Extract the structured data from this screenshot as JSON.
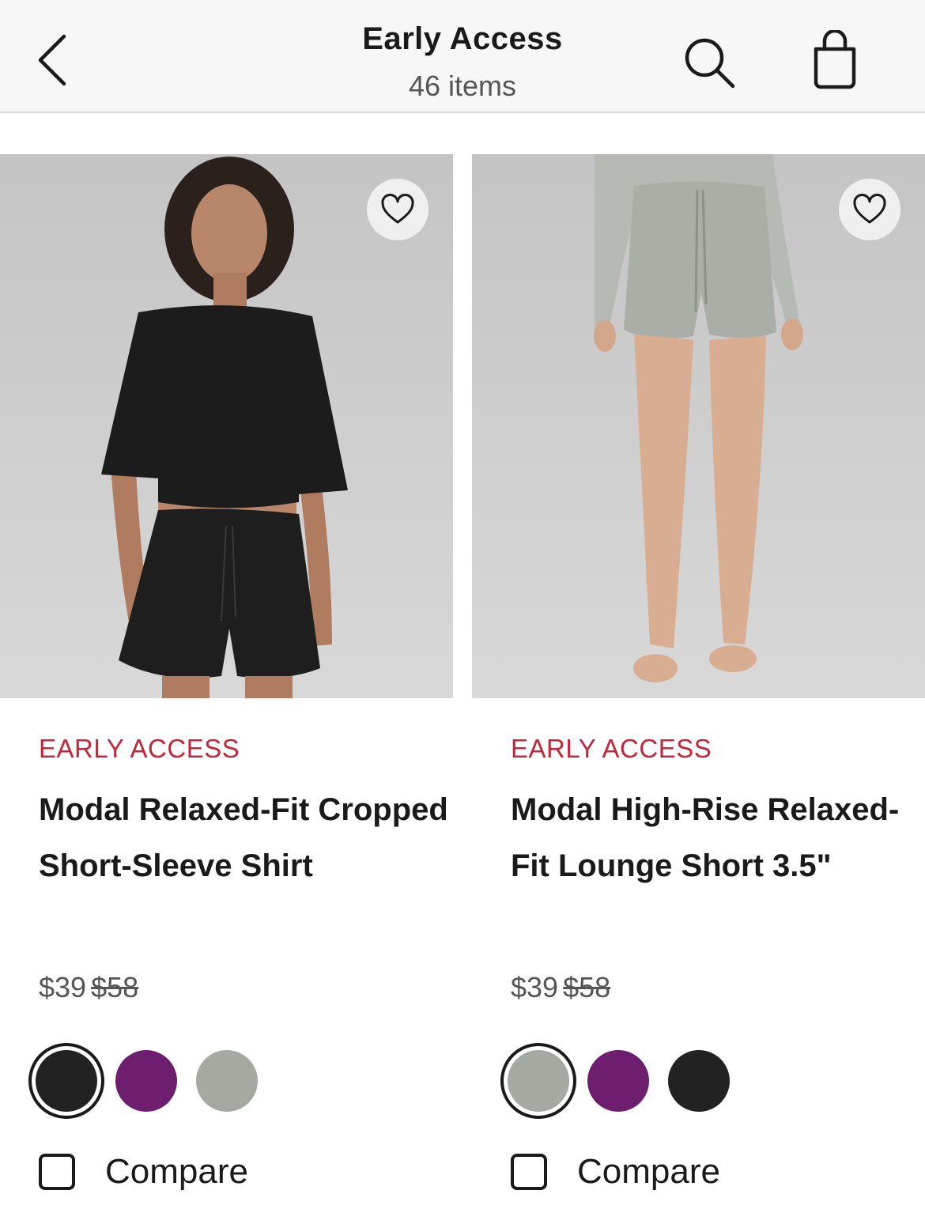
{
  "header": {
    "title": "Early Access",
    "item_count": "46 items"
  },
  "colors": {
    "accent_red": "#c0283a",
    "swatch_black": "#222222",
    "swatch_purple": "#6e1e6e",
    "swatch_sage": "#a4aaa2"
  },
  "products": [
    {
      "badge": "EARLY ACCESS",
      "name": "Modal Relaxed-Fit Cropped Short-Sleeve Shirt",
      "price_sale": "$39",
      "price_original": "$58",
      "compare_label": "Compare",
      "swatches": [
        "black",
        "purple",
        "sage"
      ],
      "selected_swatch": "black"
    },
    {
      "badge": "EARLY ACCESS",
      "name": "Modal High-Rise Relaxed-Fit Lounge Short 3.5\"",
      "price_sale": "$39",
      "price_original": "$58",
      "compare_label": "Compare",
      "swatches": [
        "sage",
        "purple",
        "black"
      ],
      "selected_swatch": "sage"
    }
  ]
}
